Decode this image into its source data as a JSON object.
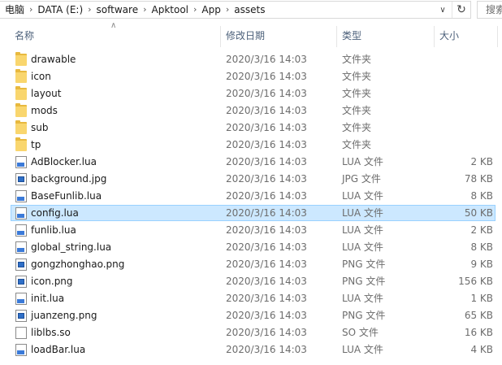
{
  "address": {
    "crumbs": [
      "电脑",
      "DATA (E:)",
      "software",
      "Apktool",
      "App",
      "assets"
    ],
    "search_placeholder": "搜索"
  },
  "columns": {
    "name": "名称",
    "date": "修改日期",
    "type": "类型",
    "size": "大小"
  },
  "rows": [
    {
      "name": "drawable",
      "date": "2020/3/16 14:03",
      "type": "文件夹",
      "size": "",
      "icon": "folder-icon"
    },
    {
      "name": "icon",
      "date": "2020/3/16 14:03",
      "type": "文件夹",
      "size": "",
      "icon": "folder-icon"
    },
    {
      "name": "layout",
      "date": "2020/3/16 14:03",
      "type": "文件夹",
      "size": "",
      "icon": "folder-icon"
    },
    {
      "name": "mods",
      "date": "2020/3/16 14:03",
      "type": "文件夹",
      "size": "",
      "icon": "folder-icon"
    },
    {
      "name": "sub",
      "date": "2020/3/16 14:03",
      "type": "文件夹",
      "size": "",
      "icon": "folder-icon"
    },
    {
      "name": "tp",
      "date": "2020/3/16 14:03",
      "type": "文件夹",
      "size": "",
      "icon": "folder-icon"
    },
    {
      "name": "AdBlocker.lua",
      "date": "2020/3/16 14:03",
      "type": "LUA 文件",
      "size": "2 KB",
      "icon": "lua-file-icon"
    },
    {
      "name": "background.jpg",
      "date": "2020/3/16 14:03",
      "type": "JPG 文件",
      "size": "78 KB",
      "icon": "image-file-icon"
    },
    {
      "name": "BaseFunlib.lua",
      "date": "2020/3/16 14:03",
      "type": "LUA 文件",
      "size": "8 KB",
      "icon": "lua-file-icon"
    },
    {
      "name": "config.lua",
      "date": "2020/3/16 14:03",
      "type": "LUA 文件",
      "size": "50 KB",
      "icon": "lua-file-icon"
    },
    {
      "name": "funlib.lua",
      "date": "2020/3/16 14:03",
      "type": "LUA 文件",
      "size": "2 KB",
      "icon": "lua-file-icon"
    },
    {
      "name": "global_string.lua",
      "date": "2020/3/16 14:03",
      "type": "LUA 文件",
      "size": "8 KB",
      "icon": "lua-file-icon"
    },
    {
      "name": "gongzhonghao.png",
      "date": "2020/3/16 14:03",
      "type": "PNG 文件",
      "size": "9 KB",
      "icon": "image-file-icon"
    },
    {
      "name": "icon.png",
      "date": "2020/3/16 14:03",
      "type": "PNG 文件",
      "size": "156 KB",
      "icon": "image-file-icon"
    },
    {
      "name": "init.lua",
      "date": "2020/3/16 14:03",
      "type": "LUA 文件",
      "size": "1 KB",
      "icon": "lua-file-icon"
    },
    {
      "name": "juanzeng.png",
      "date": "2020/3/16 14:03",
      "type": "PNG 文件",
      "size": "65 KB",
      "icon": "image-file-icon"
    },
    {
      "name": "liblbs.so",
      "date": "2020/3/16 14:03",
      "type": "SO 文件",
      "size": "16 KB",
      "icon": "blank-file-icon"
    },
    {
      "name": "loadBar.lua",
      "date": "2020/3/16 14:03",
      "type": "LUA 文件",
      "size": "4 KB",
      "icon": "lua-file-icon"
    }
  ],
  "selected_row": "config.lua",
  "colors": {
    "selection_bg": "#cce8ff",
    "selection_border": "#99d1ff",
    "header_text": "#4c607a"
  }
}
